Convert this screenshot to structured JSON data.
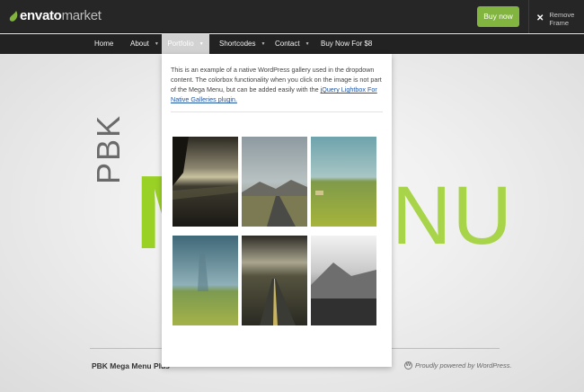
{
  "topbar": {
    "logo_brand": "envato",
    "logo_suffix": "market",
    "buy_label": "Buy now",
    "remove_frame_label": "Remove Frame"
  },
  "nav": {
    "items": [
      {
        "label": "About",
        "has_caret": true
      },
      {
        "label": "Portfolio",
        "has_caret": true,
        "active": true
      },
      {
        "label": "Shortcodes",
        "has_caret": true
      },
      {
        "label": "Contact",
        "has_caret": true
      },
      {
        "label": "Buy Now For $8",
        "has_caret": false
      }
    ],
    "home_label": "Home"
  },
  "dropdown": {
    "text_before_link": "This is an example of a native WordPress gallery used in the dropdown content. The colorbox functionality when you click on the image is not part of the Mega Menu, but can be added easily with the ",
    "link_text": "jQuery Lightbox For Native Galleries plugin.",
    "gallery": [
      {
        "name": "lake-sunset-photo"
      },
      {
        "name": "mountain-road-photo"
      },
      {
        "name": "green-field-hay-bale-photo"
      },
      {
        "name": "storm-over-plains-photo"
      },
      {
        "name": "desert-highway-photo"
      },
      {
        "name": "black-white-mountain-photo"
      }
    ]
  },
  "hero": {
    "pbk": "PBK",
    "m": "M",
    "nu": "NU"
  },
  "footer": {
    "title": "PBK Mega Menu Plus",
    "powered": "Proudly powered by WordPress."
  },
  "colors": {
    "accent_green": "#82b440",
    "hero_green": "#9ad125",
    "topbar_bg": "#262626",
    "navbar_bg": "#222222"
  }
}
